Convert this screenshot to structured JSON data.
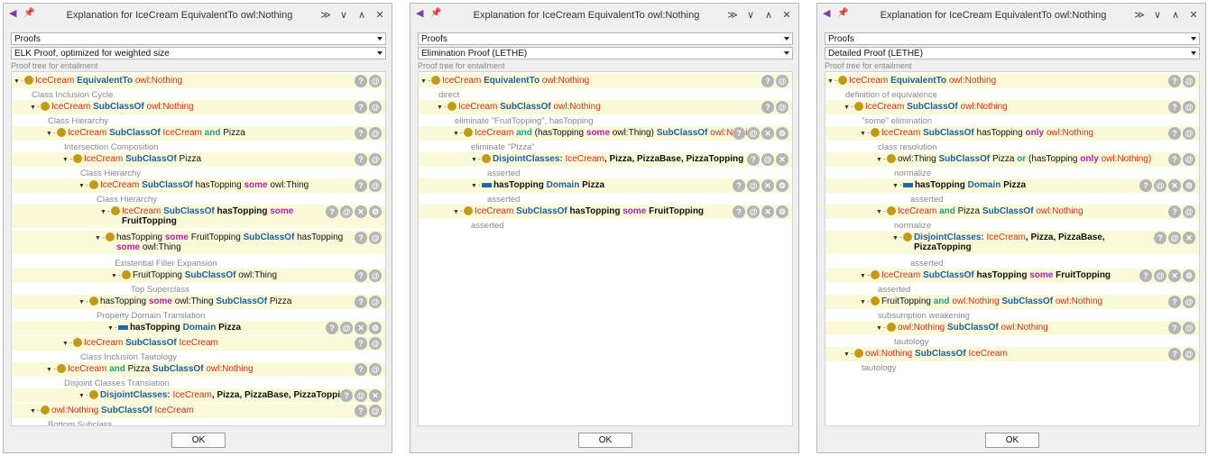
{
  "dialog_title": "Explanation for IceCream EquivalentTo owl:Nothing",
  "title_buttons": [
    "≫",
    "∨",
    "∧",
    "✕"
  ],
  "ok_label": "OK",
  "header_label": "Proof tree for entailment",
  "button_glyphs": {
    "help": "?",
    "at": "@",
    "close": "✕",
    "gear": "⚙"
  },
  "windows": [
    {
      "select1": "Proofs",
      "select2": "ELK Proof, optimized for weighted size",
      "rows": [
        {
          "seg": [
            [
              "IceCream",
              "R"
            ],
            [
              " EquivalentTo ",
              "B"
            ],
            [
              "owl:Nothing",
              "R"
            ]
          ]
        },
        {
          "lbl": "Class Inclusion Cycle"
        },
        {
          "seg": [
            [
              "IceCream",
              "R"
            ],
            [
              " SubClassOf ",
              "B"
            ],
            [
              "owl:Nothing",
              "R"
            ]
          ]
        },
        {
          "lbl": "Class Hierarchy"
        },
        {
          "seg": [
            [
              "IceCream",
              "R"
            ],
            [
              " SubClassOf ",
              "B"
            ],
            [
              "IceCream ",
              "R"
            ],
            [
              "and",
              "T"
            ],
            [
              " Pizza",
              "N"
            ]
          ]
        },
        {
          "lbl": "Intersection Composition"
        },
        {
          "seg": [
            [
              "IceCream",
              "R"
            ],
            [
              " SubClassOf ",
              "B"
            ],
            [
              "Pizza",
              "N"
            ]
          ]
        },
        {
          "lbl": "Class Hierarchy"
        },
        {
          "seg": [
            [
              "IceCream",
              "R"
            ],
            [
              " SubClassOf ",
              "B"
            ],
            [
              "hasTopping ",
              "N"
            ],
            [
              "some ",
              "M"
            ],
            [
              "owl:Thing",
              "N"
            ]
          ]
        },
        {
          "lbl": "Class Hierarchy"
        },
        {
          "seg": [
            [
              "IceCream ",
              "R"
            ],
            [
              "SubClassOf ",
              "B"
            ],
            [
              "hasTopping ",
              "K"
            ],
            [
              "some",
              "M"
            ]
          ],
          "seg2": [
            [
              "FruitTopping",
              "K"
            ]
          ]
        },
        {
          "seg": [
            [
              "hasTopping ",
              "N"
            ],
            [
              "some ",
              "M"
            ],
            [
              "FruitTopping ",
              "N"
            ],
            [
              "SubClassOf ",
              "B"
            ],
            [
              "hasTopping",
              "N"
            ]
          ],
          "seg2": [
            [
              "some ",
              "M"
            ],
            [
              "owl:Thing",
              "N"
            ]
          ]
        },
        {
          "lbl": "Existential Filler Expansion"
        },
        {
          "seg": [
            [
              "FruitTopping ",
              "N"
            ],
            [
              "SubClassOf ",
              "B"
            ],
            [
              "owl:Thing",
              "N"
            ]
          ]
        },
        {
          "lbl": "Top Superclass"
        },
        {
          "seg": [
            [
              "hasTopping ",
              "N"
            ],
            [
              "some ",
              "M"
            ],
            [
              "owl:Thing ",
              "N"
            ],
            [
              "SubClassOf ",
              "B"
            ],
            [
              "Pizza",
              "N"
            ]
          ]
        },
        {
          "lbl": "Property Domain Translation"
        },
        {
          "seg": [
            [
              "hasTopping ",
              "K"
            ],
            [
              "Domain ",
              "B"
            ],
            [
              "Pizza",
              "K"
            ]
          ]
        },
        {
          "seg": [
            [
              "IceCream ",
              "R"
            ],
            [
              "SubClassOf ",
              "B"
            ],
            [
              "IceCream",
              "R"
            ]
          ]
        },
        {
          "lbl": "Class Inclusion Tautology"
        },
        {
          "seg": [
            [
              "IceCream ",
              "R"
            ],
            [
              "and ",
              "T"
            ],
            [
              "Pizza ",
              "N"
            ],
            [
              "SubClassOf ",
              "B"
            ],
            [
              "owl:Nothing",
              "R"
            ]
          ]
        },
        {
          "lbl": "Disjoint Classes Translation"
        },
        {
          "seg": [
            [
              "DisjointClasses: ",
              "B"
            ],
            [
              "IceCream",
              "R"
            ],
            [
              ", Pizza, PizzaBase, PizzaTopping",
              "K"
            ]
          ]
        },
        {
          "seg": [
            [
              "owl:Nothing ",
              "R"
            ],
            [
              "SubClassOf ",
              "B"
            ],
            [
              "IceCream",
              "R"
            ]
          ]
        },
        {
          "lbl": "Bottom Subclass"
        }
      ]
    },
    {
      "select1": "Proofs",
      "select2": "Elimination Proof (LETHE)",
      "rows": [
        {
          "seg": [
            [
              "IceCream ",
              "R"
            ],
            [
              "EquivalentTo ",
              "B"
            ],
            [
              "owl:Nothing",
              "R"
            ]
          ]
        },
        {
          "lbl": "direct"
        },
        {
          "seg": [
            [
              "IceCream ",
              "R"
            ],
            [
              "SubClassOf ",
              "B"
            ],
            [
              "owl:Nothing",
              "R"
            ]
          ]
        },
        {
          "lbl": "eliminate \"FruitTopping\", hasTopping"
        },
        {
          "seg": [
            [
              "IceCream ",
              "R"
            ],
            [
              "and ",
              "T"
            ],
            [
              "(hasTopping ",
              "N"
            ],
            [
              "some ",
              "M"
            ],
            [
              "owl:Thing) ",
              "N"
            ],
            [
              "SubClassOf ",
              "B"
            ],
            [
              "owl:Nothing",
              "R"
            ]
          ]
        },
        {
          "lbl": "eliminate \"Pizza\""
        },
        {
          "seg": [
            [
              "DisjointClasses: ",
              "B"
            ],
            [
              "IceCream",
              "R"
            ],
            [
              ", Pizza, PizzaBase, PizzaTopping",
              "K"
            ]
          ]
        },
        {
          "lbl": "asserted"
        },
        {
          "seg": [
            [
              "hasTopping ",
              "K"
            ],
            [
              "Domain ",
              "B"
            ],
            [
              "Pizza",
              "K"
            ]
          ]
        },
        {
          "lbl": "asserted"
        },
        {
          "seg": [
            [
              "IceCream ",
              "R"
            ],
            [
              "SubClassOf ",
              "B"
            ],
            [
              "hasTopping ",
              "K"
            ],
            [
              "some ",
              "M"
            ],
            [
              "FruitTopping",
              "K"
            ]
          ]
        },
        {
          "lbl": "asserted"
        }
      ]
    },
    {
      "select1": "Proofs",
      "select2": "Detailed Proof (LETHE)",
      "rows": [
        {
          "seg": [
            [
              "IceCream ",
              "R"
            ],
            [
              "EquivalentTo ",
              "B"
            ],
            [
              "owl:Nothing",
              "R"
            ]
          ]
        },
        {
          "lbl": "definition of equivalence"
        },
        {
          "seg": [
            [
              "IceCream ",
              "R"
            ],
            [
              "SubClassOf ",
              "B"
            ],
            [
              "owl:Nothing",
              "R"
            ]
          ]
        },
        {
          "lbl": "\"some\" elimination"
        },
        {
          "seg": [
            [
              "IceCream ",
              "R"
            ],
            [
              "SubClassOf ",
              "B"
            ],
            [
              "hasTopping ",
              "N"
            ],
            [
              "only ",
              "M"
            ],
            [
              "owl:Nothing",
              "R"
            ]
          ]
        },
        {
          "lbl": "class resolution"
        },
        {
          "seg": [
            [
              "owl:Thing ",
              "N"
            ],
            [
              "SubClassOf ",
              "B"
            ],
            [
              "Pizza ",
              "N"
            ],
            [
              "or ",
              "T"
            ],
            [
              "(hasTopping ",
              "N"
            ],
            [
              "only ",
              "M"
            ],
            [
              "owl:Nothing)",
              "R"
            ]
          ]
        },
        {
          "lbl": "normalize"
        },
        {
          "seg": [
            [
              "hasTopping ",
              "K"
            ],
            [
              "Domain ",
              "B"
            ],
            [
              "Pizza",
              "K"
            ]
          ]
        },
        {
          "lbl": "asserted"
        },
        {
          "seg": [
            [
              "IceCream ",
              "R"
            ],
            [
              "and ",
              "T"
            ],
            [
              "Pizza ",
              "N"
            ],
            [
              "SubClassOf ",
              "B"
            ],
            [
              "owl:Nothing",
              "R"
            ]
          ]
        },
        {
          "lbl": "normalize"
        },
        {
          "seg": [
            [
              "DisjointClasses: ",
              "B"
            ],
            [
              "IceCream",
              "R"
            ],
            [
              ", Pizza, PizzaBase,",
              "K"
            ]
          ],
          "seg2": [
            [
              "PizzaTopping",
              "K"
            ]
          ]
        },
        {
          "lbl": "asserted"
        },
        {
          "seg": [
            [
              "IceCream ",
              "R"
            ],
            [
              "SubClassOf ",
              "B"
            ],
            [
              "hasTopping ",
              "K"
            ],
            [
              "some ",
              "M"
            ],
            [
              "FruitTopping",
              "K"
            ]
          ]
        },
        {
          "lbl": "asserted"
        },
        {
          "seg": [
            [
              "FruitTopping ",
              "N"
            ],
            [
              "and ",
              "T"
            ],
            [
              "owl:Nothing ",
              "R"
            ],
            [
              "SubClassOf ",
              "B"
            ],
            [
              "owl:Nothing",
              "R"
            ]
          ]
        },
        {
          "lbl": "subsumption weakening"
        },
        {
          "seg": [
            [
              "owl:Nothing ",
              "R"
            ],
            [
              "SubClassOf ",
              "B"
            ],
            [
              "owl:Nothing",
              "R"
            ]
          ]
        },
        {
          "lbl": "tautology"
        },
        {
          "seg": [
            [
              "owl:Nothing ",
              "R"
            ],
            [
              "SubClassOf ",
              "B"
            ],
            [
              "IceCream",
              "R"
            ]
          ]
        },
        {
          "lbl": "tautology"
        }
      ]
    }
  ]
}
